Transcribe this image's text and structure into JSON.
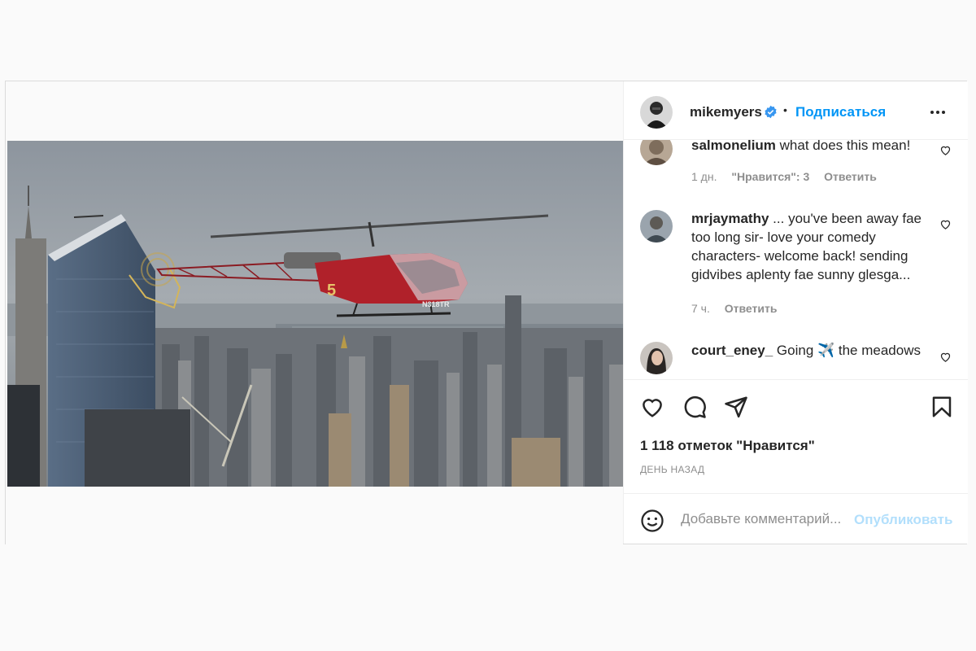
{
  "post": {
    "header": {
      "username": "mikemyers",
      "separator": "•",
      "follow_label": "Подписаться",
      "verified_icon": "verified-badge-icon",
      "more_icon": "more-options-icon"
    },
    "comments": [
      {
        "username": "salmonelium",
        "text": "what does this mean!",
        "time": "1 дн.",
        "likes": "\"Нравится\": 3",
        "reply": "Ответить"
      },
      {
        "username": "mrjaymathy",
        "text": "... you've been away fae too long sir- love your comedy characters- welcome back! sending gidvibes aplenty fae sunny glesga...",
        "time": "7 ч.",
        "reply": "Ответить"
      },
      {
        "username": "court_eney_",
        "text": "Going ✈️ the meadows"
      }
    ],
    "actions": {
      "icons": [
        "heart-icon",
        "comment-icon",
        "share-icon",
        "bookmark-icon"
      ]
    },
    "likes_text": "1 118 отметок \"Нравится\"",
    "date_text": "ДЕНЬ НАЗАД",
    "add_comment": {
      "placeholder": "Добавьте комментарий...",
      "publish_label": "Опубликовать",
      "emoji_icon": "emoji-icon"
    },
    "photo": {
      "helicopter_number": "5",
      "helicopter_registration": "N318TR"
    },
    "colors": {
      "link": "#0095f6",
      "publish_disabled": "#b2dffc",
      "text": "#262626",
      "meta": "#8e8e8e",
      "helicopter": "#b0212a"
    }
  }
}
